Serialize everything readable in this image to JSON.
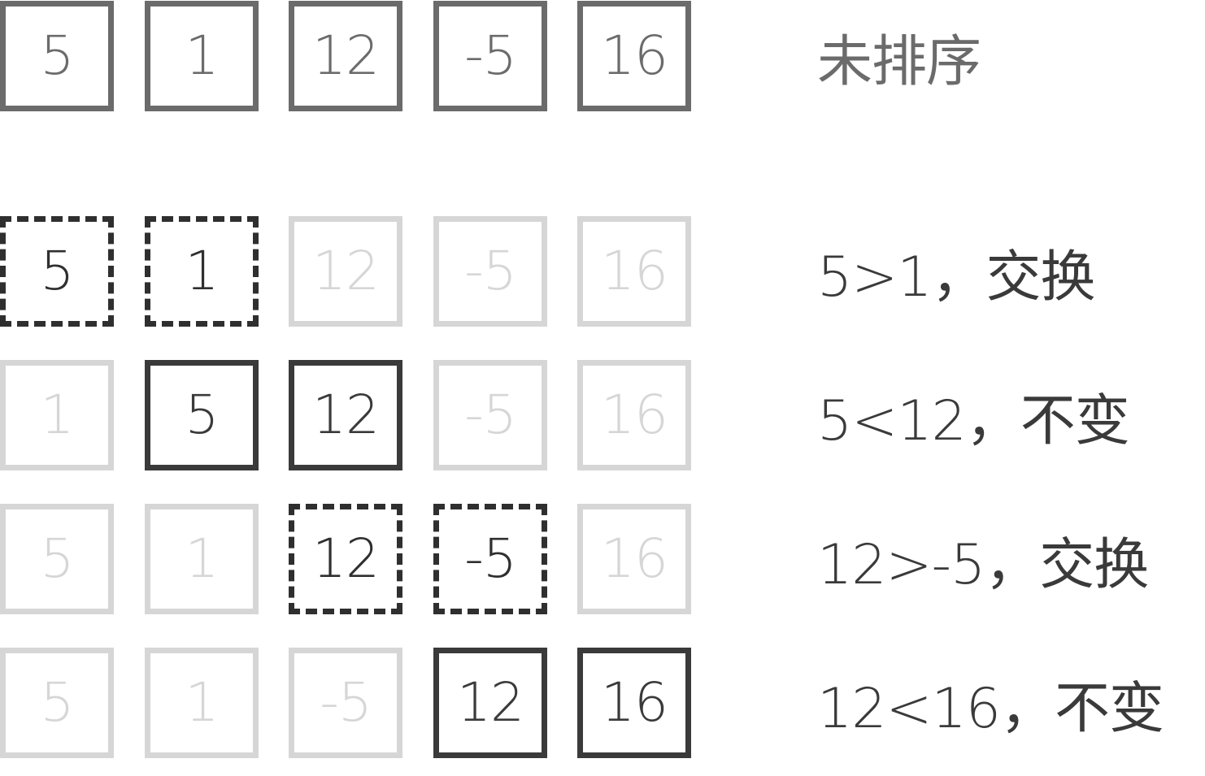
{
  "colors": {
    "initial": "#6b6b6b",
    "active": "#3a3a3a",
    "faded": "#d6d6d6"
  },
  "rows": [
    {
      "caption": "未排序",
      "cells": [
        {
          "value": "5",
          "state": "initial"
        },
        {
          "value": "1",
          "state": "initial"
        },
        {
          "value": "12",
          "state": "initial"
        },
        {
          "value": "-5",
          "state": "initial"
        },
        {
          "value": "16",
          "state": "initial"
        }
      ]
    },
    {
      "caption": "5>1，交换",
      "cells": [
        {
          "value": "5",
          "state": "swap"
        },
        {
          "value": "1",
          "state": "swap"
        },
        {
          "value": "12",
          "state": "faded"
        },
        {
          "value": "-5",
          "state": "faded"
        },
        {
          "value": "16",
          "state": "faded"
        }
      ]
    },
    {
      "caption": "5<12，不变",
      "cells": [
        {
          "value": "1",
          "state": "faded"
        },
        {
          "value": "5",
          "state": "keep"
        },
        {
          "value": "12",
          "state": "keep"
        },
        {
          "value": "-5",
          "state": "faded"
        },
        {
          "value": "16",
          "state": "faded"
        }
      ]
    },
    {
      "caption": "12>-5，交换",
      "cells": [
        {
          "value": "5",
          "state": "faded"
        },
        {
          "value": "1",
          "state": "faded"
        },
        {
          "value": "12",
          "state": "swap"
        },
        {
          "value": "-5",
          "state": "swap"
        },
        {
          "value": "16",
          "state": "faded"
        }
      ]
    },
    {
      "caption": "12<16，不变",
      "cells": [
        {
          "value": "5",
          "state": "faded"
        },
        {
          "value": "1",
          "state": "faded"
        },
        {
          "value": "-5",
          "state": "faded"
        },
        {
          "value": "12",
          "state": "keep"
        },
        {
          "value": "16",
          "state": "keep"
        }
      ]
    }
  ]
}
